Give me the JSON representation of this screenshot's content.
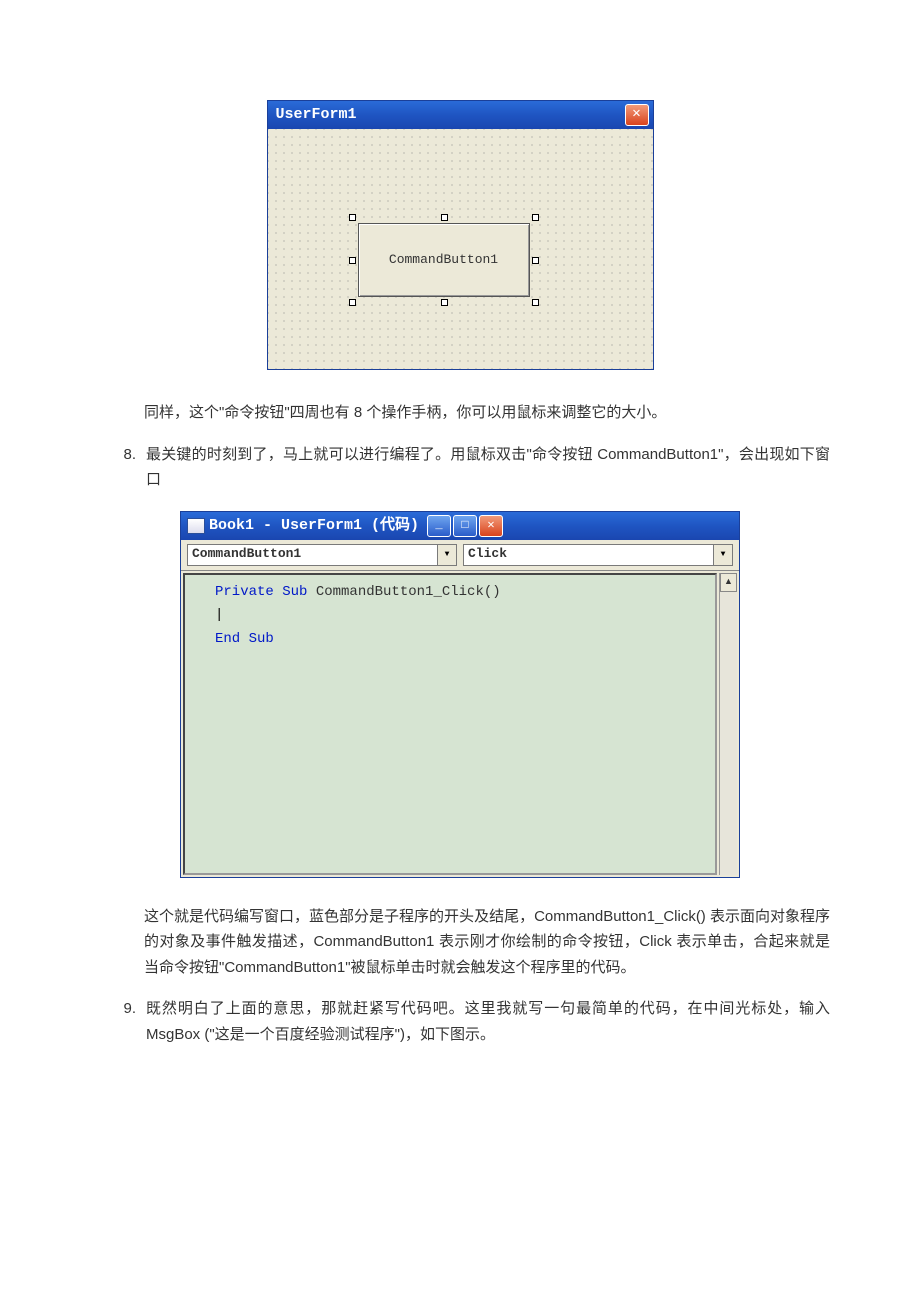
{
  "userform": {
    "title": "UserForm1",
    "button_label": "CommandButton1",
    "close_glyph": "✕"
  },
  "para_after_form": "同样，这个\"命令按钮\"四周也有 8 个操作手柄，你可以用鼠标来调整它的大小。",
  "step8": {
    "num": "8.",
    "text": "最关键的时刻到了，马上就可以进行编程了。用鼠标双击\"命令按钮 CommandButton1\"，会出现如下窗口"
  },
  "codewin": {
    "title": "Book1 - UserForm1 (代码)",
    "min_glyph": "_",
    "max_glyph": "□",
    "close_glyph": "✕",
    "object_dd": "CommandButton1",
    "proc_dd": "Click",
    "kw_private_sub": "Private Sub",
    "sub_name": " CommandButton1_Click()",
    "cursor_line": "|",
    "kw_end_sub": "End Sub",
    "up_glyph": "▲"
  },
  "para_after_code": "这个就是代码编写窗口，蓝色部分是子程序的开头及结尾，CommandButton1_Click() 表示面向对象程序的对象及事件触发描述，CommandButton1 表示刚才你绘制的命令按钮，Click 表示单击，合起来就是当命令按钮\"CommandButton1\"被鼠标单击时就会触发这个程序里的代码。",
  "step9": {
    "num": "9.",
    "text": "既然明白了上面的意思，那就赶紧写代码吧。这里我就写一句最简单的代码，在中间光标处，输入 MsgBox (\"这是一个百度经验测试程序\")，如下图示。"
  }
}
